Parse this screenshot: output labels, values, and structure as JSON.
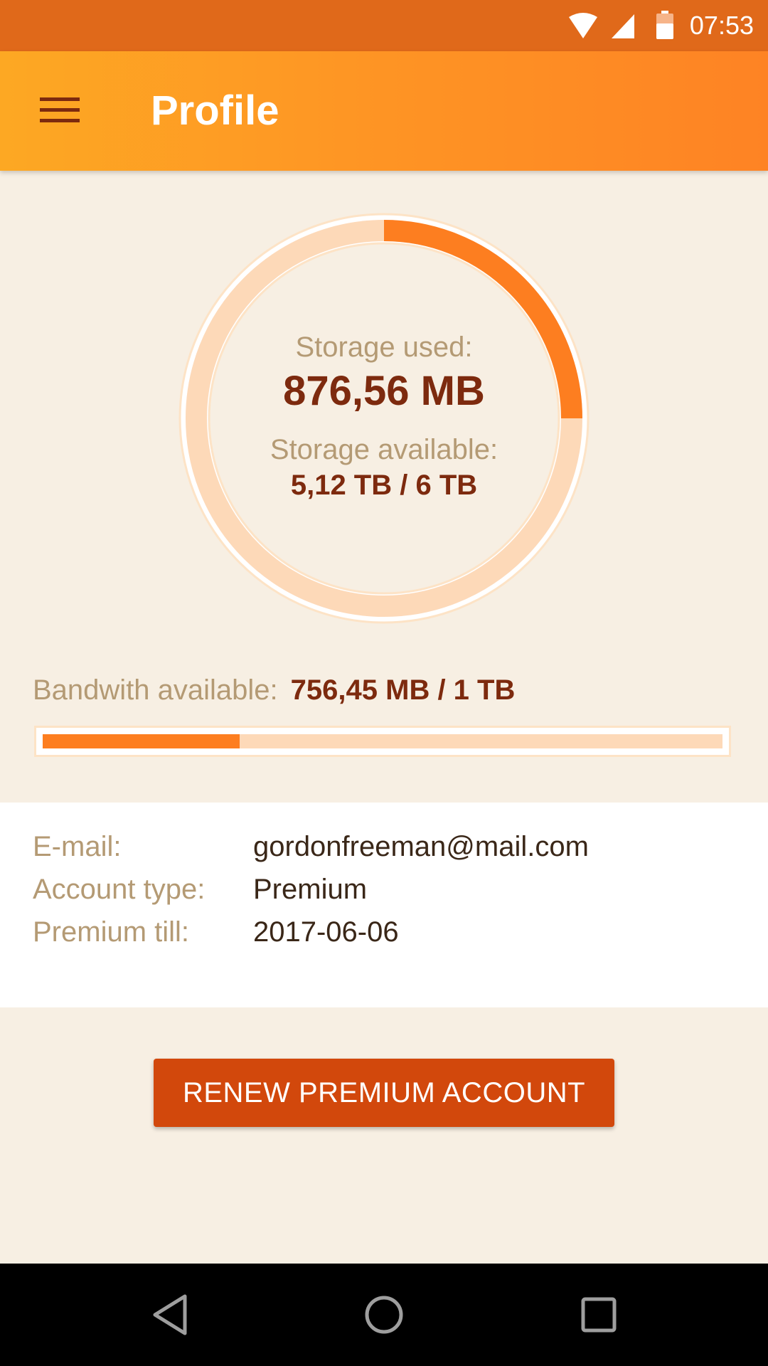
{
  "status_bar": {
    "time": "07:53",
    "icons": [
      "wifi-icon",
      "cell-signal-icon",
      "battery-icon"
    ],
    "color": "#e0691a"
  },
  "app_bar": {
    "title": "Profile",
    "menu_icon": "hamburger-menu-icon",
    "gradient": [
      "#fda823",
      "#fe8324"
    ]
  },
  "storage": {
    "used_label": "Storage used:",
    "used_value": "876,56 MB",
    "available_label": "Storage available:",
    "available_value": "5,12 TB / 6 TB",
    "ring_fill_fraction": 0.25,
    "ring_fill_color": "#fd7e20",
    "ring_track_color": "#fdd9b8"
  },
  "bandwidth": {
    "label": "Bandwith available:",
    "value": "756,45 MB / 1 TB",
    "fill_fraction": 0.29
  },
  "account": {
    "email_label": "E-mail:",
    "email_value": "gordonfreeman@mail.com",
    "type_label": "Account type:",
    "type_value": "Premium",
    "premium_label": "Premium till:",
    "premium_value": "2017-06-06"
  },
  "actions": {
    "renew_label": "RENEW PREMIUM ACCOUNT",
    "renew_color": "#d2480c"
  },
  "nav_bar": {
    "icons": [
      "back-icon",
      "home-icon",
      "recents-icon"
    ]
  }
}
